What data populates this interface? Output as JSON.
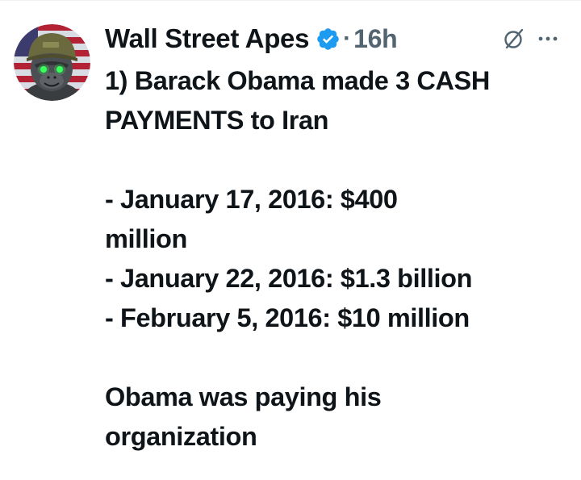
{
  "author": {
    "name": "Wall Street Apes",
    "verified": true,
    "avatar_icon": "gorilla-soldier-avatar"
  },
  "separator": "·",
  "timestamp": "16h",
  "icons": {
    "verified": "verified-badge-icon",
    "grok": "grok-icon",
    "more": "more-icon"
  },
  "colors": {
    "verified_blue": "#1d9bf0",
    "text": "#0f1419",
    "secondary_text": "#536471"
  },
  "tweet": {
    "lines": [
      "1) Barack Obama made 3 CASH",
      "PAYMENTS to Iran",
      "- January 17, 2016: $400",
      "million",
      "- January 22, 2016: $1.3 billion",
      "- February 5, 2016: $10 million",
      "Obama was paying his",
      "organization"
    ]
  }
}
